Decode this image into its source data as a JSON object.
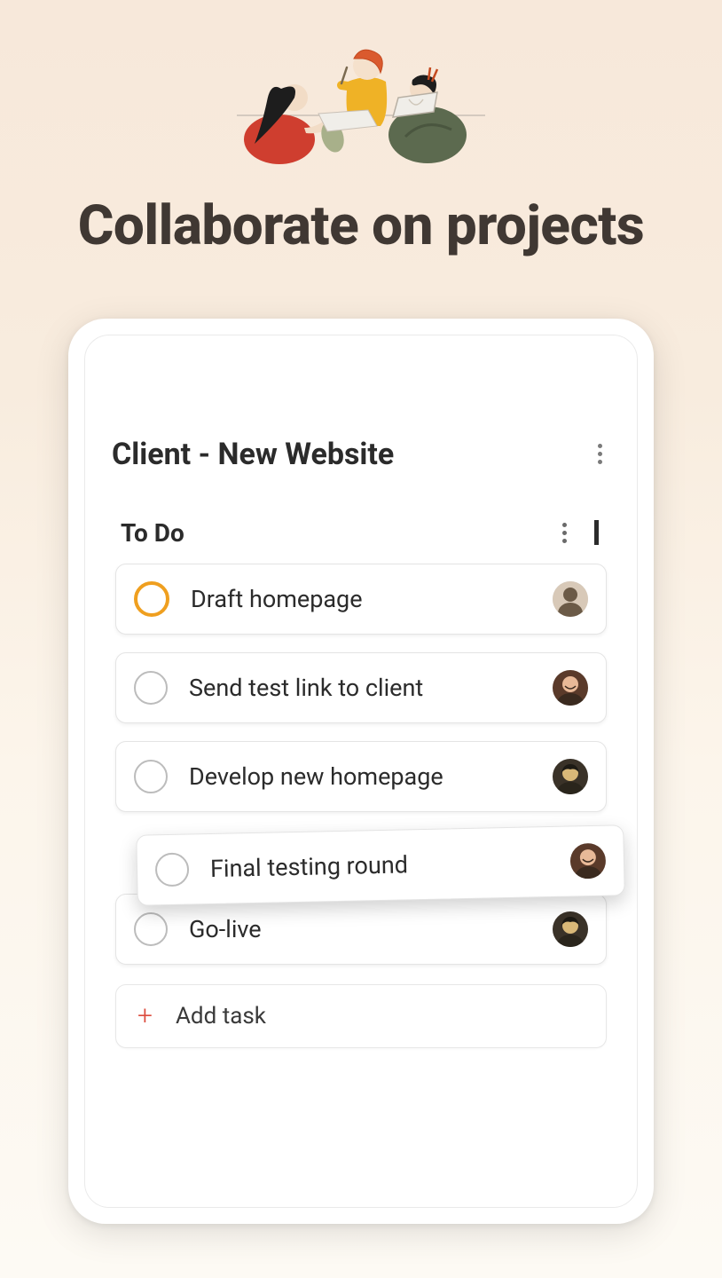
{
  "heading": "Collaborate on projects",
  "project": {
    "title": "Client - New Website"
  },
  "section": {
    "title": "To Do"
  },
  "tasks": [
    {
      "title": "Draft homepage",
      "highlight": true,
      "avatar_bg": "#d8c9b8",
      "avatar_fg": "#6b5a47"
    },
    {
      "title": "Send test link to client",
      "highlight": false,
      "avatar_bg": "#5a3a2a",
      "avatar_fg": "#e8b998"
    },
    {
      "title": "Develop new homepage",
      "highlight": false,
      "avatar_bg": "#3a3228",
      "avatar_fg": "#d9b878"
    },
    {
      "title": "Final testing round",
      "highlight": false,
      "avatar_bg": "#5a3a2a",
      "avatar_fg": "#e8b998"
    },
    {
      "title": "Go-live",
      "highlight": false,
      "avatar_bg": "#3a3228",
      "avatar_fg": "#d9b878"
    }
  ],
  "add_task_label": "Add task"
}
